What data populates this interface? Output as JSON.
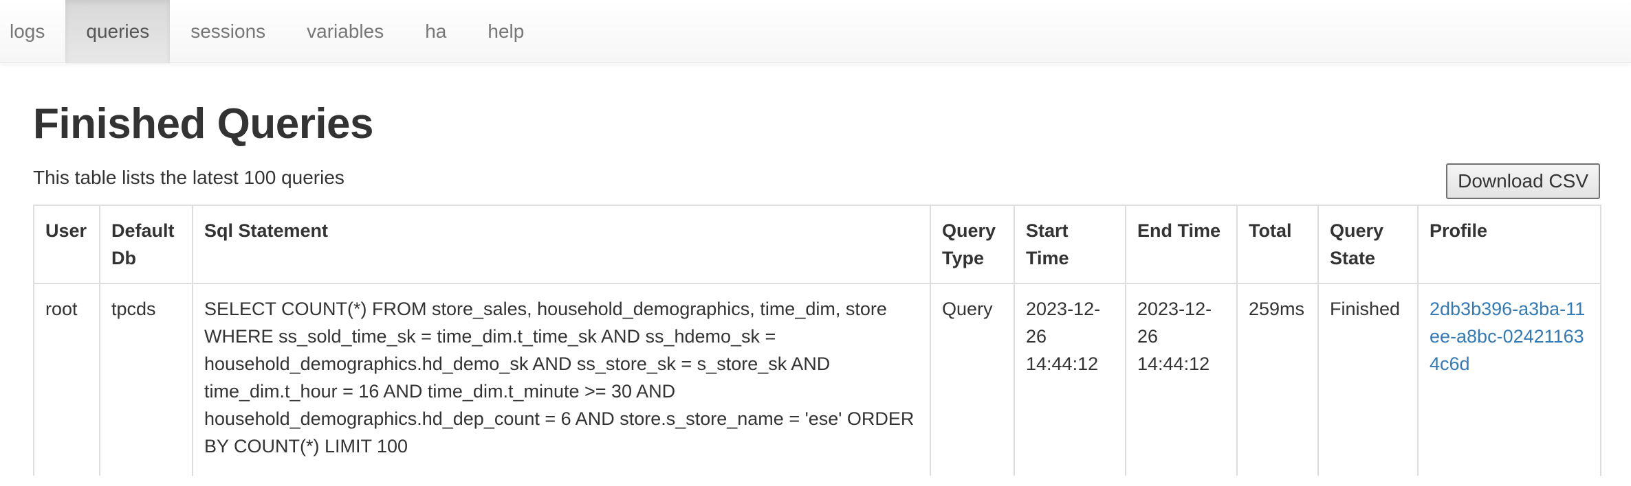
{
  "nav": {
    "items": [
      {
        "label": "logs"
      },
      {
        "label": "queries"
      },
      {
        "label": "sessions"
      },
      {
        "label": "variables"
      },
      {
        "label": "ha"
      },
      {
        "label": "help"
      }
    ],
    "active": "queries"
  },
  "page": {
    "title": "Finished Queries",
    "subtitle": "This table lists the latest 100 queries",
    "download_label": "Download CSV"
  },
  "table": {
    "headers": [
      "User",
      "Default Db",
      "Sql Statement",
      "Query Type",
      "Start Time",
      "End Time",
      "Total",
      "Query State",
      "Profile"
    ],
    "rows": [
      {
        "user": "root",
        "default_db": "tpcds",
        "sql": "SELECT COUNT(*) FROM store_sales, household_demographics, time_dim, store WHERE ss_sold_time_sk = time_dim.t_time_sk AND ss_hdemo_sk = household_demographics.hd_demo_sk AND ss_store_sk = s_store_sk AND time_dim.t_hour = 16 AND time_dim.t_minute >= 30 AND household_demographics.hd_dep_count = 6 AND store.s_store_name = 'ese' ORDER BY COUNT(*) LIMIT 100",
        "query_type": "Query",
        "start_time": "2023-12-26 14:44:12",
        "end_time": "2023-12-26 14:44:12",
        "total": "259ms",
        "query_state": "Finished",
        "profile": "2db3b396-a3ba-11ee-a8bc-024211634c6d"
      }
    ]
  },
  "colors": {
    "link": "#337ab7",
    "active_tab_bg": "#dddddd",
    "text": "#333333"
  }
}
